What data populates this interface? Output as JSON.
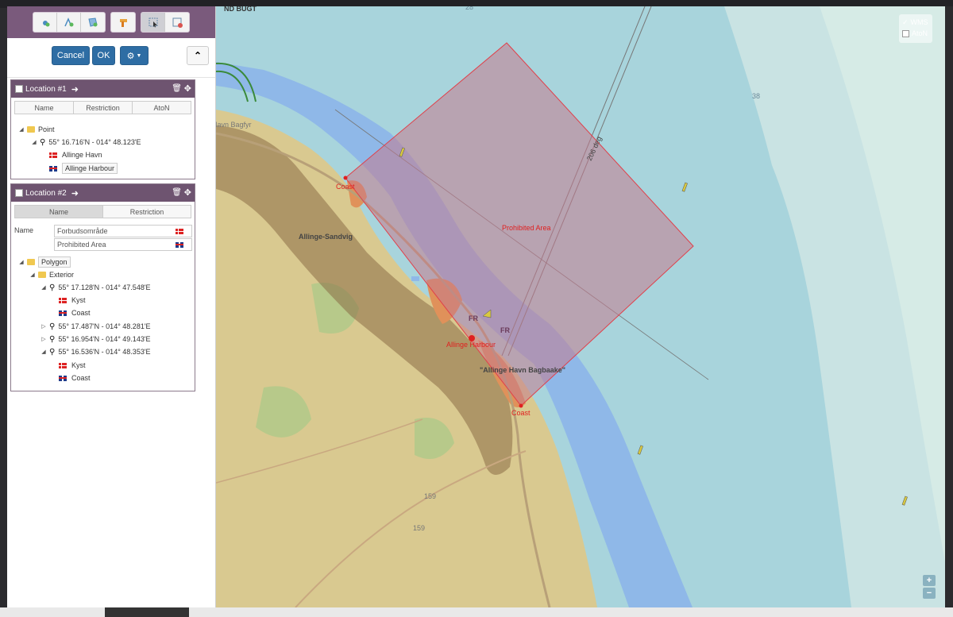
{
  "toolbar": {
    "icons": [
      "add-point-icon",
      "add-line-icon",
      "add-polygon-icon",
      "add-aton-icon",
      "select-icon",
      "delete-feature-icon"
    ]
  },
  "actions": {
    "cancel_label": "Cancel",
    "ok_label": "OK",
    "settings_icon": "gear-icon",
    "collapse_icon": "chevron-up-icon"
  },
  "location1": {
    "title": "Location #1",
    "tabs": [
      "Name",
      "Restriction",
      "AtoN"
    ],
    "tree": {
      "type": "Point",
      "coord": "55° 16.716'N - 014° 48.123'E",
      "name_da": "Allinge Havn",
      "name_en": "Allinge Harbour"
    }
  },
  "location2": {
    "title": "Location #2",
    "tabs": [
      "Name",
      "Restriction"
    ],
    "name_label": "Name",
    "name_da": "Forbudsområde",
    "name_en": "Prohibited Area",
    "tree": {
      "type": "Polygon",
      "ring": "Exterior",
      "points": [
        {
          "coord": "55° 17.128'N - 014° 47.548'E",
          "da": "Kyst",
          "en": "Coast"
        },
        {
          "coord": "55° 17.487'N - 014° 48.281'E"
        },
        {
          "coord": "55° 16.954'N - 014° 49.143'E"
        },
        {
          "coord": "55° 16.536'N - 014° 48.353'E",
          "da": "Kyst",
          "en": "Coast"
        }
      ]
    }
  },
  "map": {
    "labels": {
      "bay": "ND BUGT",
      "depth_top": "28",
      "depth_right": "38",
      "town": "Allinge-Sandvig",
      "coast_nw": "Coast",
      "coast_se": "Coast",
      "prohibited": "Prohibited Area",
      "harbour": "Allinge Harbour",
      "bagbaake": "\"Allinge Havn Bagbaake\"",
      "fr1": "FR",
      "fr2": "FR",
      "route": "206 deg",
      "road1": "159",
      "road2": "159",
      "lighthouse": "Sandvig Havn Bagfyr"
    },
    "layers": {
      "wms": "WMS",
      "aton": "AtoN",
      "wms_checked": true,
      "aton_checked": false
    },
    "zoom_in": "+",
    "zoom_out": "−",
    "colors": {
      "sea": "#a8d4dc",
      "shallow": "#8fb8e8",
      "land": "#d9c990",
      "restricted": "#b04040",
      "polygon_fill": "#c47a8e"
    }
  }
}
